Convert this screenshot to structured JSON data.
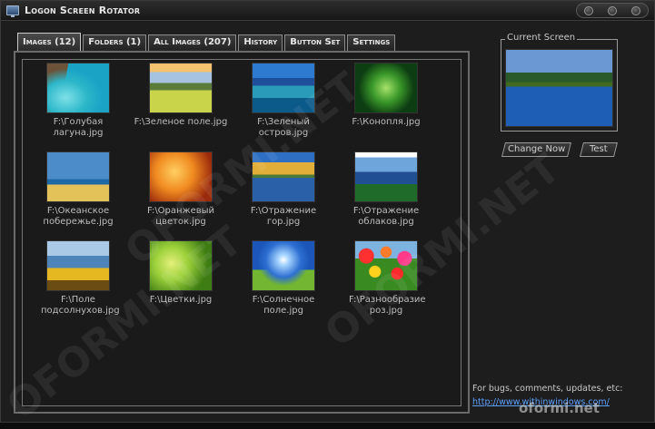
{
  "window": {
    "title": "Logon Screen Rotator"
  },
  "tabs": [
    {
      "label": "Images (12)",
      "active": true
    },
    {
      "label": "Folders (1)",
      "active": false
    },
    {
      "label": "All Images (207)",
      "active": false
    },
    {
      "label": "History",
      "active": false
    },
    {
      "label": "Button Set",
      "active": false
    },
    {
      "label": "Settings",
      "active": false
    }
  ],
  "images": [
    {
      "caption": "F:\\Голубая лагуна.jpg",
      "icon": "lagoon-thumbnail"
    },
    {
      "caption": "F:\\Зеленое поле.jpg",
      "icon": "green-field-thumbnail"
    },
    {
      "caption": "F:\\Зеленый остров.jpg",
      "icon": "green-island-thumbnail"
    },
    {
      "caption": "F:\\Конопля.jpg",
      "icon": "hemp-thumbnail"
    },
    {
      "caption": "F:\\Океанское побережье.jpg",
      "icon": "ocean-coast-thumbnail"
    },
    {
      "caption": "F:\\Оранжевый цветок.jpg",
      "icon": "orange-flower-thumbnail"
    },
    {
      "caption": "F:\\Отражение гор.jpg",
      "icon": "mountain-reflection-thumbnail"
    },
    {
      "caption": "F:\\Отражение облаков.jpg",
      "icon": "cloud-reflection-thumbnail"
    },
    {
      "caption": "F:\\Поле подсолнухов.jpg",
      "icon": "sunflower-field-thumbnail"
    },
    {
      "caption": "F:\\Цветки.jpg",
      "icon": "flowers-thumbnail"
    },
    {
      "caption": "F:\\Солнечное поле.jpg",
      "icon": "sunny-field-thumbnail"
    },
    {
      "caption": "F:\\Разнообразие роз.jpg",
      "icon": "rose-variety-thumbnail"
    }
  ],
  "current_screen": {
    "legend": "Current Screen",
    "change_now_label": "Change Now",
    "test_label": "Test"
  },
  "footer": {
    "text": "For bugs, comments, updates, etc:",
    "link": "http://www.withinwindows.com/"
  },
  "watermark": {
    "text": "OFORMI.NET",
    "corner_text": "oformi.net"
  }
}
